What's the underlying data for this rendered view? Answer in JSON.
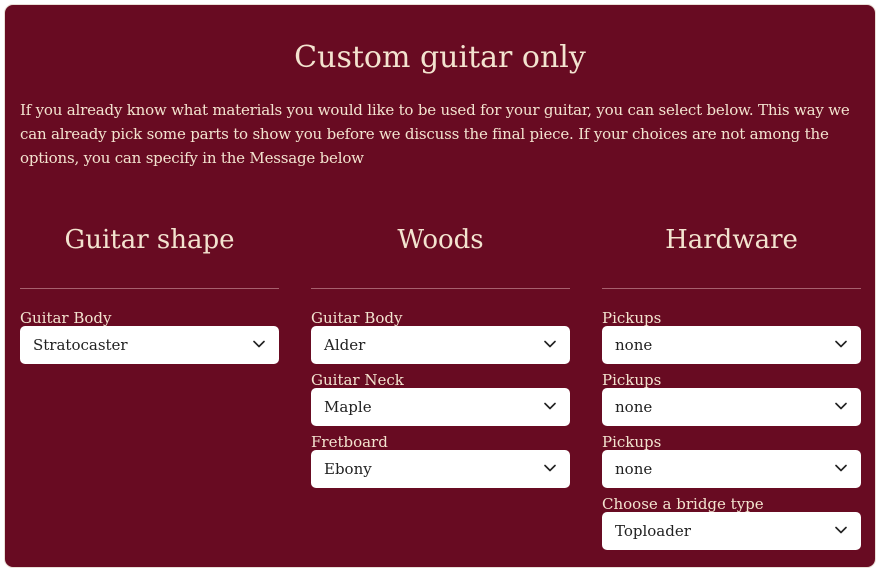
{
  "heading": "Custom guitar only",
  "intro": "If you already know what materials you would like to be used for your guitar, you can select below. This way we can already pick some parts to show you before we discuss the final piece. If your choices are not among the options, you can specify in the Message below",
  "columns": [
    {
      "title": "Guitar shape",
      "fields": [
        {
          "label": "Guitar Body",
          "value": "Stratocaster"
        }
      ]
    },
    {
      "title": "Woods",
      "fields": [
        {
          "label": "Guitar Body",
          "value": "Alder"
        },
        {
          "label": "Guitar Neck",
          "value": "Maple"
        },
        {
          "label": "Fretboard",
          "value": "Ebony"
        }
      ]
    },
    {
      "title": "Hardware",
      "fields": [
        {
          "label": "Pickups",
          "value": "none"
        },
        {
          "label": "Pickups",
          "value": "none"
        },
        {
          "label": "Pickups",
          "value": "none"
        },
        {
          "label": "Choose a bridge type",
          "value": "Toploader"
        }
      ]
    }
  ],
  "icons": {
    "dropdown": "chevron-down-icon"
  },
  "colors": {
    "panel_background": "#680b22",
    "text": "#f3e3cf",
    "select_background": "#ffffff"
  }
}
